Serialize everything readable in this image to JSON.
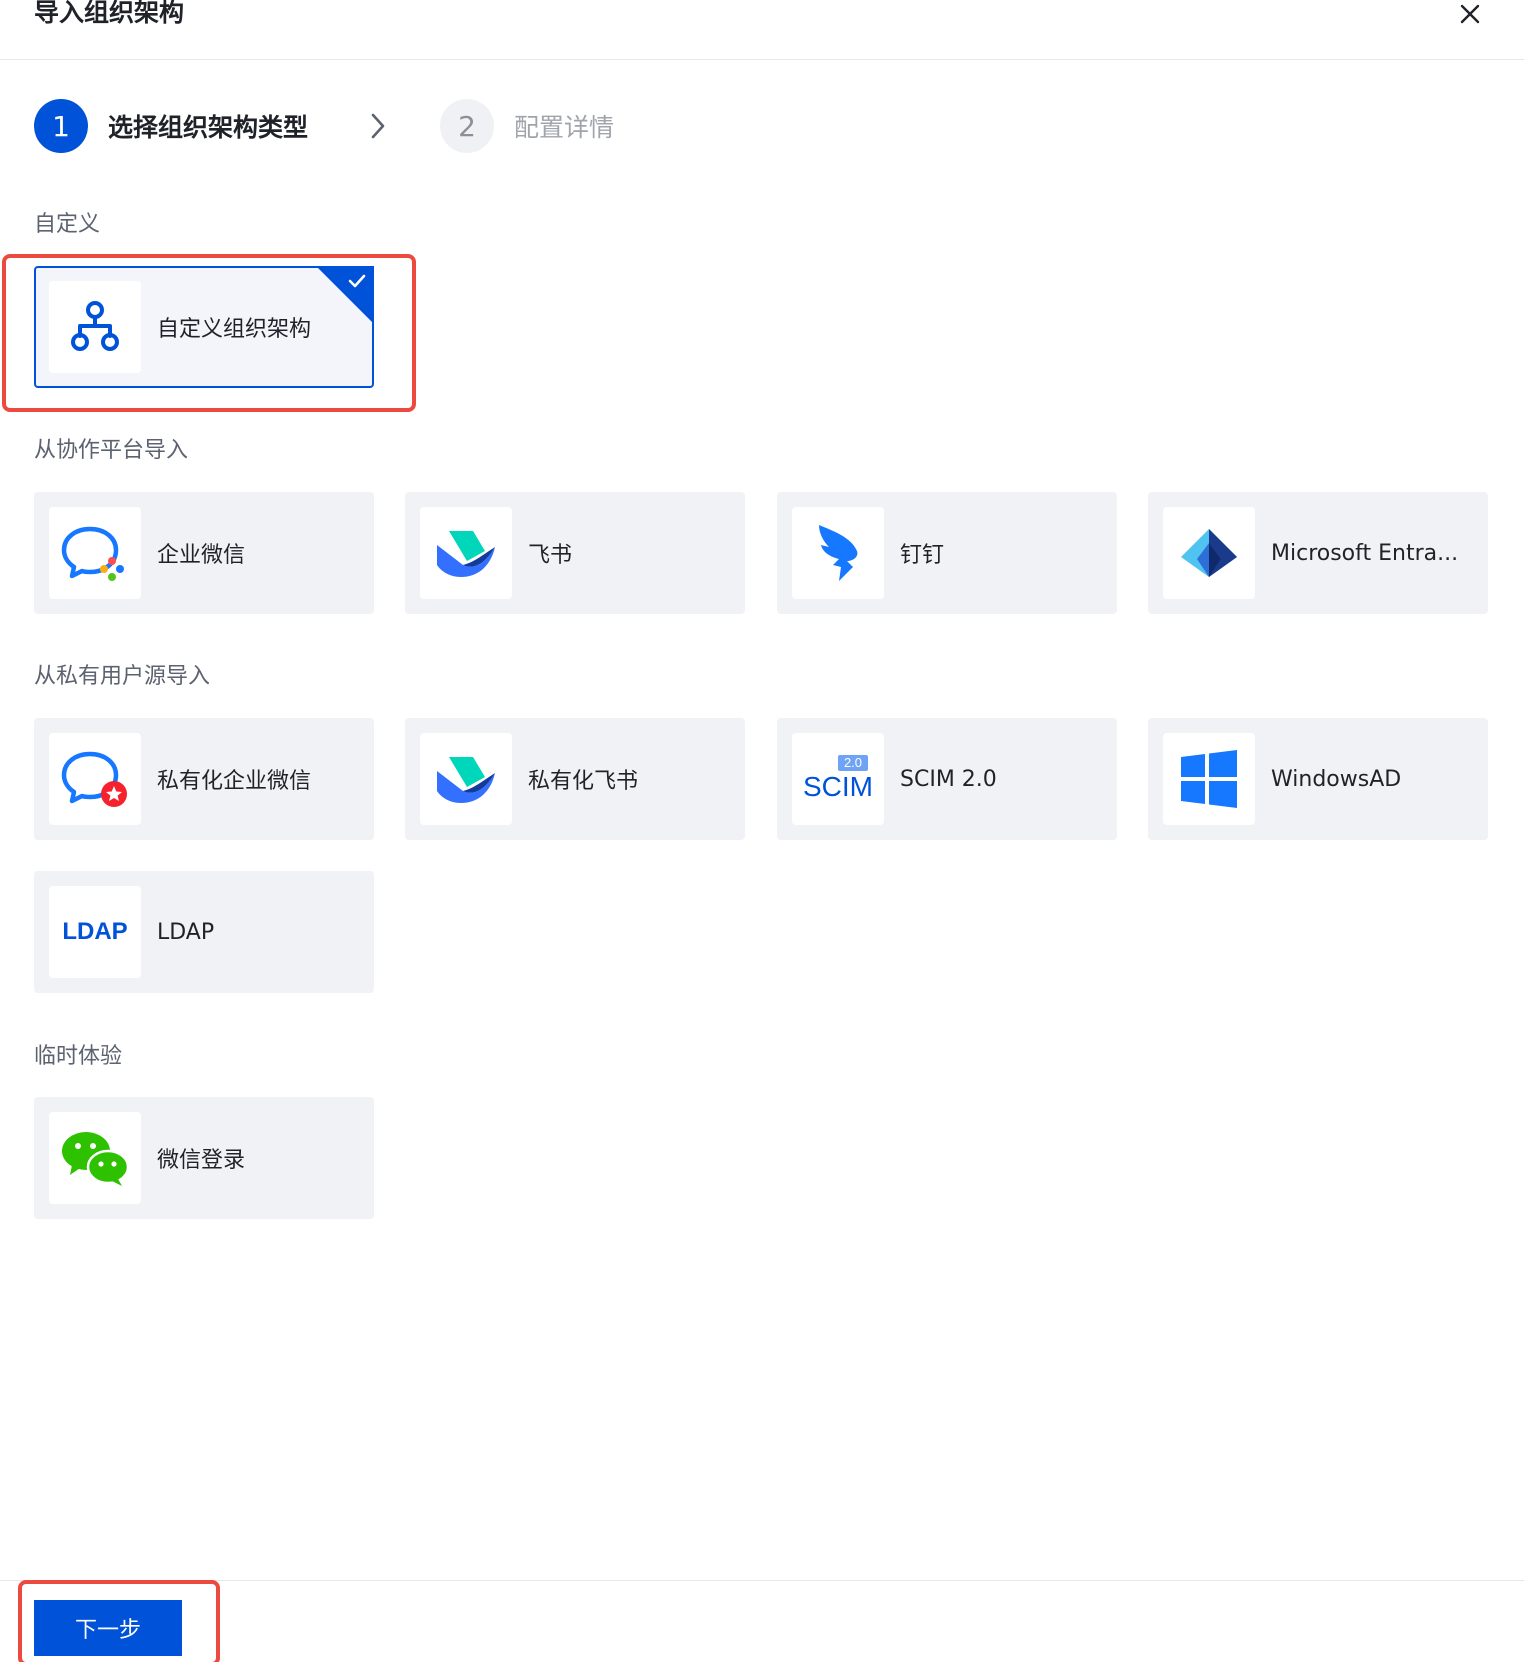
{
  "dialog": {
    "title": "导入组织架构"
  },
  "steps": [
    {
      "number": "1",
      "label": "选择组织架构类型"
    },
    {
      "number": "2",
      "label": "配置详情"
    }
  ],
  "sections": {
    "custom": "自定义",
    "collab": "从协作平台导入",
    "private": "从私有用户源导入",
    "temp": "临时体验"
  },
  "cards": {
    "custom_org": "自定义组织架构",
    "wecom": "企业微信",
    "feishu": "飞书",
    "dingtalk": "钉钉",
    "entra": "Microsoft Entra...",
    "private_wecom": "私有化企业微信",
    "private_feishu": "私有化飞书",
    "scim": "SCIM 2.0",
    "windowsad": "WindowsAD",
    "ldap": "LDAP",
    "wechat_login": "微信登录"
  },
  "icons": {
    "scim_text": "SCIM",
    "scim_badge": "2.0",
    "ldap_text": "LDAP"
  },
  "footer": {
    "next_label": "下一步"
  },
  "colors": {
    "primary": "#0052d9",
    "highlight": "#ec4a3f",
    "card_bg": "#f1f2f6"
  }
}
